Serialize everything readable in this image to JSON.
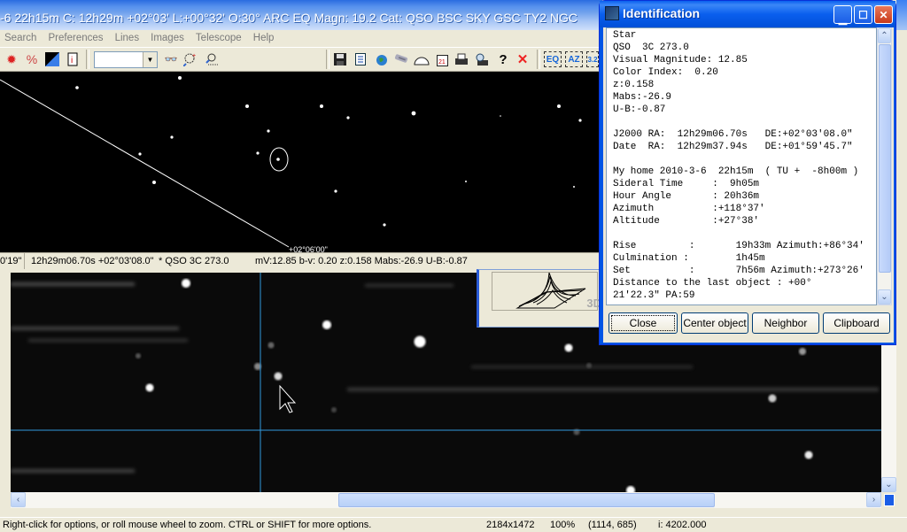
{
  "main_window": {
    "title_bar": "-6  22h15m C: 12h29m +02°03' L:+00°32' O:30° ARC EQ Magn: 19.2 Cat: QSO BSC SKY GSC TY2 NGC",
    "menu": [
      "Search",
      "Preferences",
      "Lines",
      "Images",
      "Telescope",
      "Help"
    ],
    "toolbar_left": [
      {
        "icon": "bulb-icon",
        "glyph": "💡"
      },
      {
        "icon": "percent-icon",
        "glyph": "%"
      },
      {
        "icon": "contrast-icon",
        "glyph": "◩"
      },
      {
        "icon": "info-icon",
        "glyph": "🛈"
      }
    ],
    "toolbar_combo": {
      "value": ""
    },
    "toolbar_find": [
      {
        "icon": "binoculars-icon",
        "glyph": "👓"
      },
      {
        "icon": "zoom-search-icon",
        "glyph": "🔍"
      },
      {
        "icon": "zoom-select-icon",
        "glyph": "🔎"
      }
    ],
    "toolbar_right": [
      {
        "icon": "save-icon",
        "glyph": "💾"
      },
      {
        "icon": "document-icon",
        "glyph": "🗎"
      },
      {
        "icon": "globe-icon",
        "glyph": "🌍"
      },
      {
        "icon": "telescope-icon",
        "glyph": "🔭"
      },
      {
        "icon": "dome-icon",
        "glyph": "◠"
      },
      {
        "icon": "calendar-icon",
        "glyph": "📅"
      },
      {
        "icon": "print-icon",
        "glyph": "🖶"
      },
      {
        "icon": "print-preview-icon",
        "glyph": "🖨"
      },
      {
        "icon": "help-icon",
        "glyph": "?"
      },
      {
        "icon": "close-x-icon",
        "glyph": "✕"
      }
    ],
    "toolbar_grid": [
      {
        "icon": "eq-grid-icon",
        "label": "EQ"
      },
      {
        "icon": "az-grid-icon",
        "label": "AZ"
      },
      {
        "icon": "scale-grid-icon",
        "label": "3.2"
      }
    ]
  },
  "chart_status": {
    "fov": "0'19\"",
    "coords": "12h29m06.70s +02°03'08.0\"",
    "object": "* QSO  3C 273.0",
    "info": "mV:12.85 b-v: 0.20 z:0.158 Mabs:-26.9 U-B:-0.87",
    "grid_label": "+02°06'00\""
  },
  "panel3d": {
    "label": "3D"
  },
  "identification": {
    "title": "Identification",
    "lines": [
      "Star",
      "QSO  3C 273.0",
      "Visual Magnitude: 12.85",
      "Color Index:  0.20",
      "z:0.158",
      "Mabs:-26.9",
      "U-B:-0.87",
      "",
      "J2000 RA:  12h29m06.70s   DE:+02°03'08.0\"",
      "Date  RA:  12h29m37.94s   DE:+01°59'45.7\"",
      "",
      "My home 2010-3-6  22h15m  ( TU +  -8h00m )",
      "Sideral Time     :  9h05m",
      "Hour Angle       : 20h36m",
      "Azimuth          :+118°37'",
      "Altitude         :+27°38'",
      "",
      "Rise         :       19h33m Azimuth:+86°34'",
      "Culmination :        1h45m",
      "Set          :       7h56m Azimuth:+273°26'",
      "Distance to the last object : +00°",
      "21'22.3\" PA:59"
    ],
    "buttons": {
      "close": "Close",
      "center": "Center object",
      "neighbor": "Neighbor",
      "clipboard": "Clipboard"
    }
  },
  "status_bar": {
    "hint": "Right-click for options, or roll mouse wheel to zoom. CTRL or SHIFT for more options.",
    "dimensions": "2184x1472",
    "zoom": "100%",
    "cursor": "(1114, 685)",
    "intensity": "i: 4202.000"
  },
  "colors": {
    "crosshair": "#3399dd",
    "titlebar": "#0055e5"
  }
}
